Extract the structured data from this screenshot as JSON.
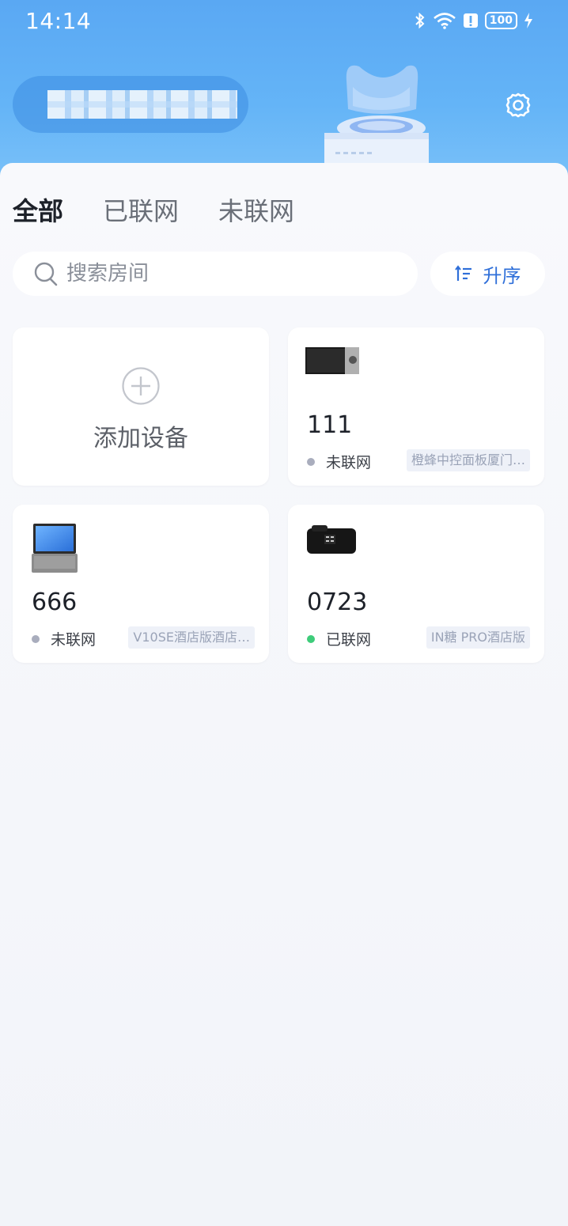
{
  "status_bar": {
    "time": "14:14",
    "battery": "100"
  },
  "header": {
    "gear_icon": "gear-icon"
  },
  "tabs": [
    {
      "label": "全部",
      "active": true
    },
    {
      "label": "已联网",
      "active": false
    },
    {
      "label": "未联网",
      "active": false
    }
  ],
  "search": {
    "placeholder": "搜索房间",
    "value": ""
  },
  "sort": {
    "label": "升序"
  },
  "add_device": {
    "label": "添加设备"
  },
  "devices": [
    {
      "name": "111",
      "status": "未联网",
      "online": false,
      "tag": "橙蜂中控面板厦门…"
    },
    {
      "name": "666",
      "status": "未联网",
      "online": false,
      "tag": "V10SE酒店版酒店…"
    },
    {
      "name": "0723",
      "status": "已联网",
      "online": true,
      "tag": "IN糖 PRO酒店版"
    }
  ],
  "colors": {
    "accent": "#2f6fd9",
    "online": "#3ecc7a",
    "offline": "#a9adbd"
  }
}
